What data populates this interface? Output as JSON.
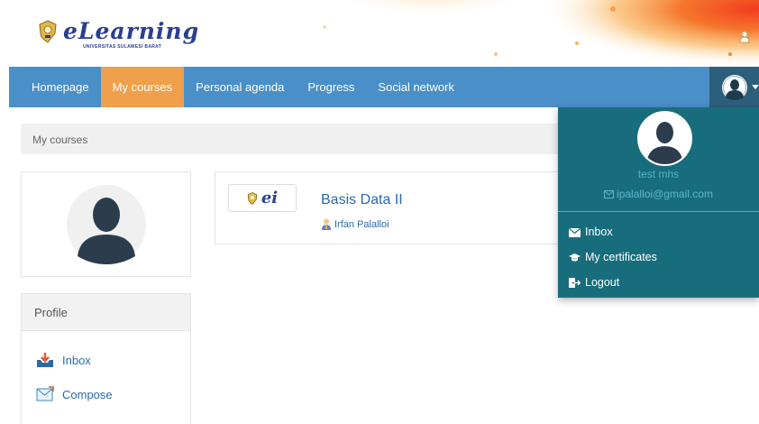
{
  "header": {
    "logo_text": "eLearning",
    "logo_subtitle": "UNIVERSITAS SULAWESI BARAT",
    "brand_color": "#2a3f8f"
  },
  "nav": {
    "items": [
      {
        "label": "Homepage",
        "active": false
      },
      {
        "label": "My courses",
        "active": true
      },
      {
        "label": "Personal agenda",
        "active": false
      },
      {
        "label": "Progress",
        "active": false
      },
      {
        "label": "Social network",
        "active": false
      }
    ],
    "bar_color": "#4a8fc7",
    "active_color": "#f0a04b"
  },
  "breadcrumb": {
    "label": "My courses"
  },
  "profile": {
    "heading": "Profile",
    "links": [
      {
        "label": "Inbox",
        "icon": "inbox-icon"
      },
      {
        "label": "Compose",
        "icon": "compose-icon"
      }
    ]
  },
  "course": {
    "thumb_text": "ei",
    "title": "Basis Data II",
    "teacher": "Irfan Palalloi"
  },
  "user_menu": {
    "name": "test mhs",
    "email": "ipalalloi@gmail.com",
    "items": [
      {
        "label": "Inbox",
        "icon": "envelope-icon"
      },
      {
        "label": "My certificates",
        "icon": "graduation-cap-icon"
      },
      {
        "label": "Logout",
        "icon": "sign-out-icon"
      }
    ],
    "bg_color": "#186d7d"
  }
}
